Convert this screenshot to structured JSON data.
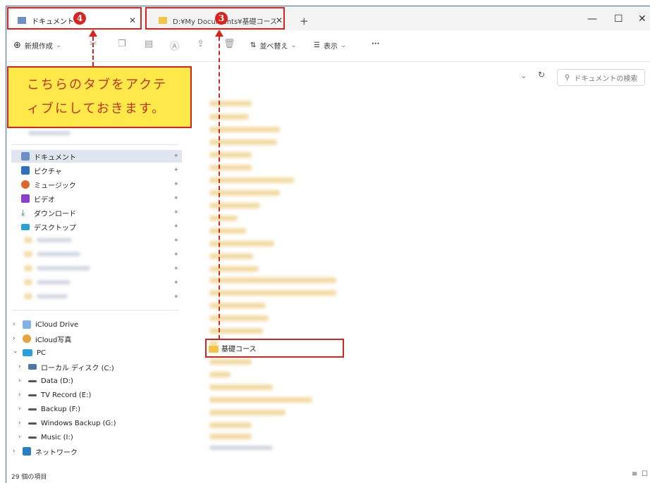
{
  "tabs": [
    {
      "label": "ドキュメント",
      "active": true
    },
    {
      "label": "D:¥My Documents¥基礎コース",
      "active": false
    }
  ],
  "new_tab_label": "+",
  "window_controls": {
    "minimize": "—",
    "maximize": "☐",
    "close": "✕"
  },
  "toolbar": {
    "new_label": "新規作成",
    "sort_label": "並べ替え",
    "view_label": "表示",
    "more_label": "···"
  },
  "address": {
    "search_placeholder": "ドキュメントの検索"
  },
  "nav": {
    "quick": [
      {
        "label": "ドキュメント",
        "color": "#6b8fc7"
      },
      {
        "label": "ピクチャ",
        "color": "#2f6fbf"
      },
      {
        "label": "ミュージック",
        "color": "#e0652b"
      },
      {
        "label": "ビデオ",
        "color": "#8a3fd0"
      },
      {
        "label": "ダウンロード",
        "color": "#2a8a3a"
      },
      {
        "label": "デスクトップ",
        "color": "#2aa0d8"
      }
    ],
    "tree": [
      {
        "label": "iCloud Drive",
        "chev": "›"
      },
      {
        "label": "iCloud写真",
        "chev": "›"
      },
      {
        "label": "PC",
        "chev": "⌄"
      },
      {
        "label": "ローカル ディスク (C:)",
        "chev": "›"
      },
      {
        "label": "Data (D:)",
        "chev": "›"
      },
      {
        "label": "TV Record (E:)",
        "chev": "›"
      },
      {
        "label": "Backup (F:)",
        "chev": "›"
      },
      {
        "label": "Windows Backup (G:)",
        "chev": "›"
      },
      {
        "label": "Music (I:)",
        "chev": "›"
      },
      {
        "label": "ネットワーク",
        "chev": "›"
      }
    ]
  },
  "content": {
    "highlighted_folder": "基礎コース"
  },
  "status": {
    "item_count": "29 個の項目"
  },
  "annotations": {
    "badge_active": "4",
    "badge_target": "3",
    "callout_line1": "こちらのタブをアクテ",
    "callout_line2": "ィブにしておきます。"
  },
  "colors": {
    "accent_red": "#d9231c",
    "callout_bg": "#ffe94a",
    "folder": "#f4c447"
  }
}
